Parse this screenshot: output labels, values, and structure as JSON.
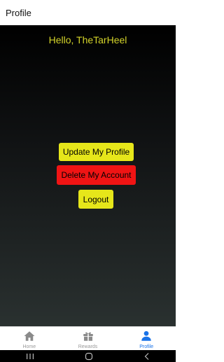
{
  "header": {
    "title": "Profile"
  },
  "profile": {
    "greeting": "Hello, TheTarHeel",
    "update_label": "Update My Profile",
    "delete_label": "Delete My Account",
    "logout_label": "Logout"
  },
  "tabs": [
    {
      "label": "Home",
      "icon": "home-icon",
      "active": false
    },
    {
      "label": "Rewards",
      "icon": "gift-icon",
      "active": false
    },
    {
      "label": "Profile",
      "icon": "person-icon",
      "active": true
    }
  ],
  "colors": {
    "accent_yellow": "#e6e61a",
    "danger_red": "#f01414",
    "greeting_text": "#d4d42a",
    "active_tab": "#1a73e8",
    "inactive_tab": "#9a9a9a"
  }
}
